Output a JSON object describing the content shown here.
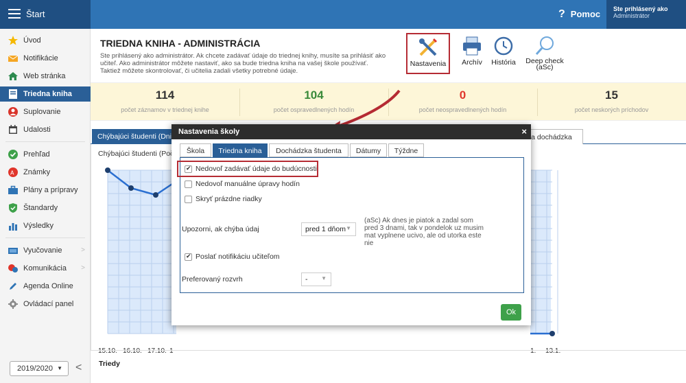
{
  "topbar": {
    "start_label": "Štart",
    "help_label": "Pomoc",
    "help_icon": "?",
    "user_line1": "Ste prihlásený ako",
    "user_line2": "Administrátor"
  },
  "sidebar": {
    "items": [
      {
        "label": "Úvod",
        "icon": "star-icon"
      },
      {
        "label": "Notifikácie",
        "icon": "envelope-icon"
      },
      {
        "label": "Web stránka",
        "icon": "home-icon"
      },
      {
        "label": "Triedna kniha",
        "icon": "book-icon",
        "active": true
      },
      {
        "label": "Suplovanie",
        "icon": "person-icon"
      },
      {
        "label": "Udalosti",
        "icon": "calendar-icon"
      },
      {
        "label": "Prehľad",
        "icon": "check-circle-icon"
      },
      {
        "label": "Známky",
        "icon": "grade-icon"
      },
      {
        "label": "Plány a prípravy",
        "icon": "briefcase-icon"
      },
      {
        "label": "Štandardy",
        "icon": "shield-icon"
      },
      {
        "label": "Výsledky",
        "icon": "bar-chart-icon"
      },
      {
        "label": "Vyučovanie",
        "icon": "blackboard-icon"
      },
      {
        "label": "Komunikácia",
        "icon": "chat-icon"
      },
      {
        "label": "Agenda Online",
        "icon": "pencil-icon"
      },
      {
        "label": "Ovládací panel",
        "icon": "gear-icon"
      }
    ],
    "year": "2019/2020",
    "collapse": "<"
  },
  "main": {
    "title": "TRIEDNA KNIHA - ADMINISTRÁCIA",
    "description": "Ste prihlásený ako administrátor. Ak chcete zadávať údaje do triednej knihy, musíte sa prihlásiť ako učiteľ. Ako administrátor môžete nastaviť, ako sa bude triedna kniha na vašej škole používať. Taktiež môžete skontrolovať, či učitelia zadali všetky potrebné údaje.",
    "tools": [
      {
        "label": "Nastavenia",
        "icon": "settings-tools-icon"
      },
      {
        "label": "Archív",
        "icon": "printer-icon"
      },
      {
        "label": "História",
        "icon": "clock-icon"
      },
      {
        "label": "Deep check (aSc)",
        "icon": "magnifier-icon"
      }
    ],
    "stats": [
      {
        "value": "114",
        "label": "počet záznamov v triednej knihe",
        "color": "#222222"
      },
      {
        "value": "104",
        "label": "počet ospravedlnených hodín",
        "color": "#3a8a3a"
      },
      {
        "value": "0",
        "label": "počet neospravedlnených hodín",
        "color": "#e0352b"
      },
      {
        "value": "15",
        "label": "počet neskorých príchodov",
        "color": "#222222"
      }
    ],
    "tab_active": "Chýbajúci študenti (Dni)",
    "tab_right": "árna dochádzka",
    "chart_title": "Chýbajúci študenti (Poč",
    "chart_x_labels": [
      "15.10.",
      "16.10.",
      "17.10.",
      "1",
      "1.",
      "13.1."
    ],
    "triedy_label": "Triedy"
  },
  "modal": {
    "title": "Nastavenia školy",
    "close": "×",
    "tabs": [
      "Škola",
      "Triedna kniha",
      "Dochádzka študenta",
      "Dátumy",
      "Týždne"
    ],
    "checkboxes": [
      {
        "label": "Nedovoľ zadávať údaje do budúcnosti",
        "checked": true
      },
      {
        "label": "Nedovoľ manuálne úpravy hodín",
        "checked": false
      },
      {
        "label": "Skryť prázdne riadky",
        "checked": false
      },
      {
        "label": "Poslať notifikáciu učiteľom",
        "checked": true
      }
    ],
    "upozorni_label": "Upozorni, ak chýba údaj",
    "upozorni_value": "pred 1 dňom",
    "note": "(aSc) Ak dnes je piatok a zadal som pred 3 dnami, tak v pondelok uz musim mat vyplnene ucivo, ale od utorka este nie",
    "rozvrh_label": "Preferovaný rozvrh",
    "rozvrh_value": "-",
    "ok_label": "Ok"
  },
  "colors": {
    "accent": "#2a5f97",
    "topbar": "#2f74b5",
    "highlight": "#b52b33",
    "ok": "#3ea14a",
    "chart_line": "#2a6fd1"
  }
}
